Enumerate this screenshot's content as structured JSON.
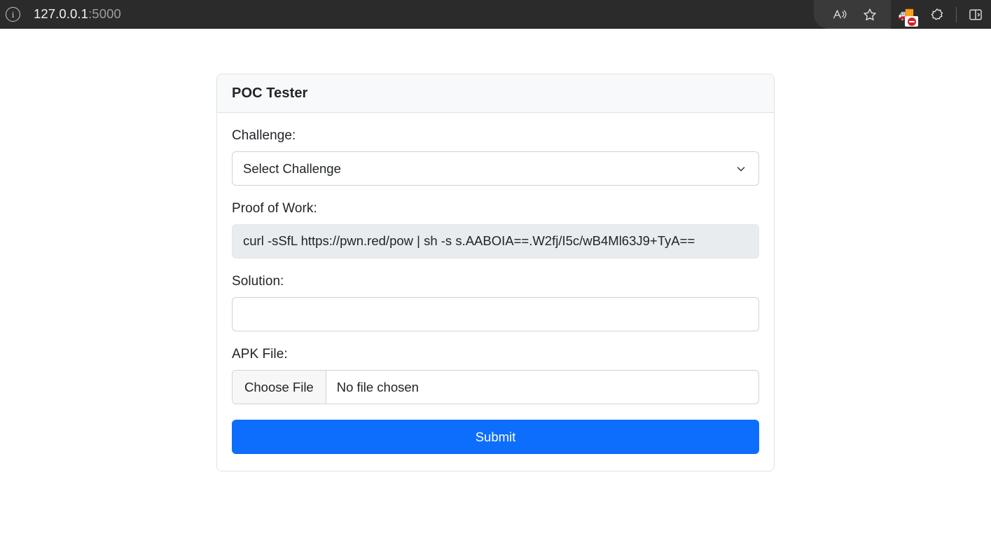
{
  "browser": {
    "site_info_icon": "info-circle-icon",
    "url_host": "127.0.0.1",
    "url_port": ":5000",
    "toolbar": {
      "read_aloud_label": "read-aloud-icon",
      "favorite_label": "favorite-star-icon",
      "extension_label": "extension-icon",
      "extension_badge": "blocked-badge-icon",
      "collections_label": "collections-icon",
      "split_screen_label": "split-screen-icon"
    }
  },
  "card": {
    "title": "POC Tester",
    "fields": {
      "challenge": {
        "label": "Challenge:",
        "selected_option": "Select Challenge",
        "options": [
          "Select Challenge"
        ],
        "icon": "chevron-down-icon"
      },
      "proof_of_work": {
        "label": "Proof of Work:",
        "value": "curl -sSfL https://pwn.red/pow | sh -s s.AABOIA==.W2fj/I5c/wB4Ml63J9+TyA=="
      },
      "solution": {
        "label": "Solution:",
        "value": "",
        "placeholder": ""
      },
      "apk_file": {
        "label": "APK File:",
        "button_label": "Choose File",
        "status_text": "No file chosen"
      }
    },
    "submit_label": "Submit"
  },
  "colors": {
    "primary": "#0d6efd",
    "chrome_bg": "#2b2b2b",
    "card_border": "#dee2e6",
    "header_bg": "#f8f9fa",
    "readonly_bg": "#e9ecef"
  }
}
